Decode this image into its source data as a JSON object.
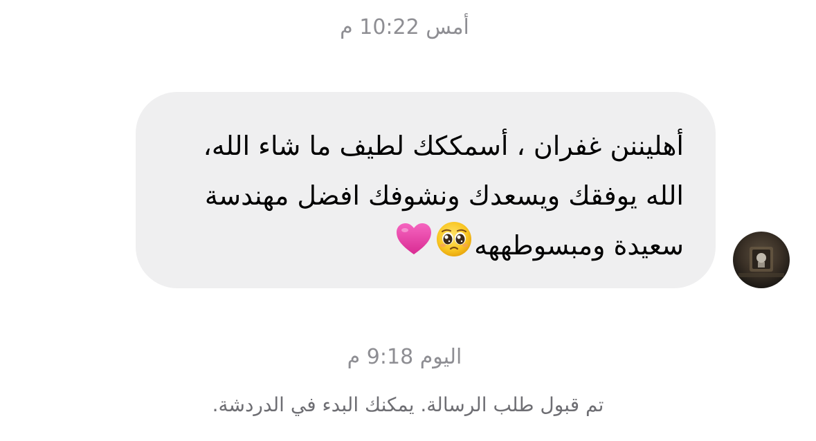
{
  "timestamps": {
    "previous": "أمس 10:22 م",
    "today": "اليوم 9:18 م"
  },
  "message": {
    "line1": "أهليننن غفران ، أسمككك لطيف  ما شاء الله،",
    "line2": "الله يوفقك ويسعدك ونشوفك افضل مهندسة",
    "line3": "سعيدة ومبسوطههه"
  },
  "emojis": [
    "pleading-face-icon",
    "pink-heart-icon"
  ],
  "system_message": "تم قبول طلب الرسالة. يمكنك البدء في الدردشة.",
  "colors": {
    "bubble": "#efeff0",
    "timestamp_text": "#8e8e93",
    "message_text": "#000000",
    "heart": "#e83fa0"
  }
}
